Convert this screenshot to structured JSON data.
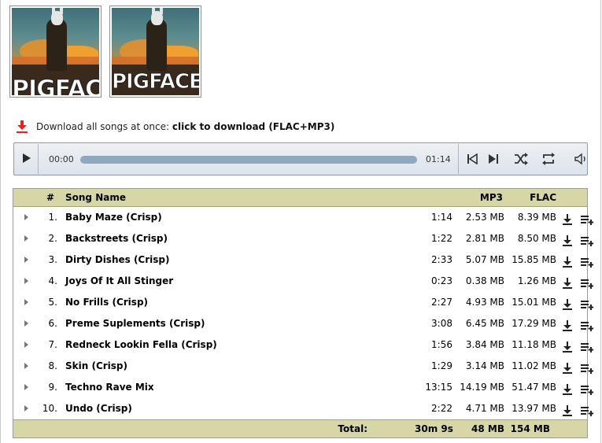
{
  "albums": [
    {
      "cover_text": "PIGFACE"
    },
    {
      "cover_text": "PIGFACE"
    }
  ],
  "download_all": {
    "text": "Download all songs at once:",
    "link": "click to download (FLAC+MP3)",
    "icon": "download-arrow-icon",
    "icon_color": "#e8201e"
  },
  "player": {
    "current_time": "00:00",
    "duration": "01:14",
    "progress": 0.0,
    "icons": [
      "play-icon",
      "previous-icon",
      "next-icon",
      "shuffle-icon",
      "repeat-icon",
      "volume-icon"
    ]
  },
  "table": {
    "headers": {
      "num": "#",
      "name": "Song Name",
      "mp3": "MP3",
      "flac": "FLAC"
    },
    "rows": [
      {
        "num": "1.",
        "name": "Baby Maze (Crisp)",
        "duration": "1:14",
        "mp3": "2.53 MB",
        "flac": "8.39 MB"
      },
      {
        "num": "2.",
        "name": "Backstreets (Crisp)",
        "duration": "1:22",
        "mp3": "2.81 MB",
        "flac": "8.50 MB"
      },
      {
        "num": "3.",
        "name": "Dirty Dishes (Crisp)",
        "duration": "2:33",
        "mp3": "5.07 MB",
        "flac": "15.85 MB"
      },
      {
        "num": "4.",
        "name": "Joys Of It All Stinger",
        "duration": "0:23",
        "mp3": "0.38 MB",
        "flac": "1.26 MB"
      },
      {
        "num": "5.",
        "name": "No Frills (Crisp)",
        "duration": "2:27",
        "mp3": "4.93 MB",
        "flac": "15.01 MB"
      },
      {
        "num": "6.",
        "name": "Preme Suplements (Crisp)",
        "duration": "3:08",
        "mp3": "6.45 MB",
        "flac": "17.29 MB"
      },
      {
        "num": "7.",
        "name": "Redneck Lookin Fella (Crisp)",
        "duration": "1:56",
        "mp3": "3.84 MB",
        "flac": "11.18 MB"
      },
      {
        "num": "8.",
        "name": "Skin (Crisp)",
        "duration": "1:29",
        "mp3": "3.14 MB",
        "flac": "11.02 MB"
      },
      {
        "num": "9.",
        "name": "Techno Rave Mix",
        "duration": "13:15",
        "mp3": "14.19 MB",
        "flac": "51.47 MB"
      },
      {
        "num": "10.",
        "name": "Undo (Crisp)",
        "duration": "2:22",
        "mp3": "4.71 MB",
        "flac": "13.97 MB"
      }
    ],
    "footer": {
      "label": "Total:",
      "duration": "30m 9s",
      "mp3": "48 MB",
      "flac": "154 MB"
    },
    "header_bg": "#d7d6a7"
  }
}
